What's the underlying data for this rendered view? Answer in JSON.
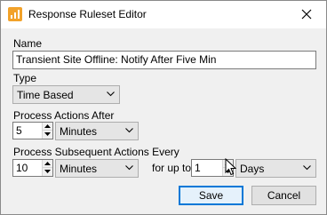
{
  "window": {
    "title": "Response Ruleset Editor",
    "icon": "chart-bars-icon",
    "close_icon": "close-icon"
  },
  "form": {
    "name_label": "Name",
    "name_value": "Transient Site Offline: Notify After Five Min",
    "type_label": "Type",
    "type_value": "Time Based",
    "process_after_label": "Process Actions After",
    "process_after_value": "5",
    "process_after_unit": "Minutes",
    "subsequent_label": "Process Subsequent Actions Every",
    "subsequent_value": "10",
    "subsequent_unit": "Minutes",
    "for_up_to_label": "for up to",
    "for_up_to_value": "1",
    "for_up_to_unit": "Days"
  },
  "buttons": {
    "save": "Save",
    "cancel": "Cancel"
  },
  "colors": {
    "accent": "#0078d7",
    "icon": "#f2a22a",
    "window_bg": "#f0f0f0"
  }
}
